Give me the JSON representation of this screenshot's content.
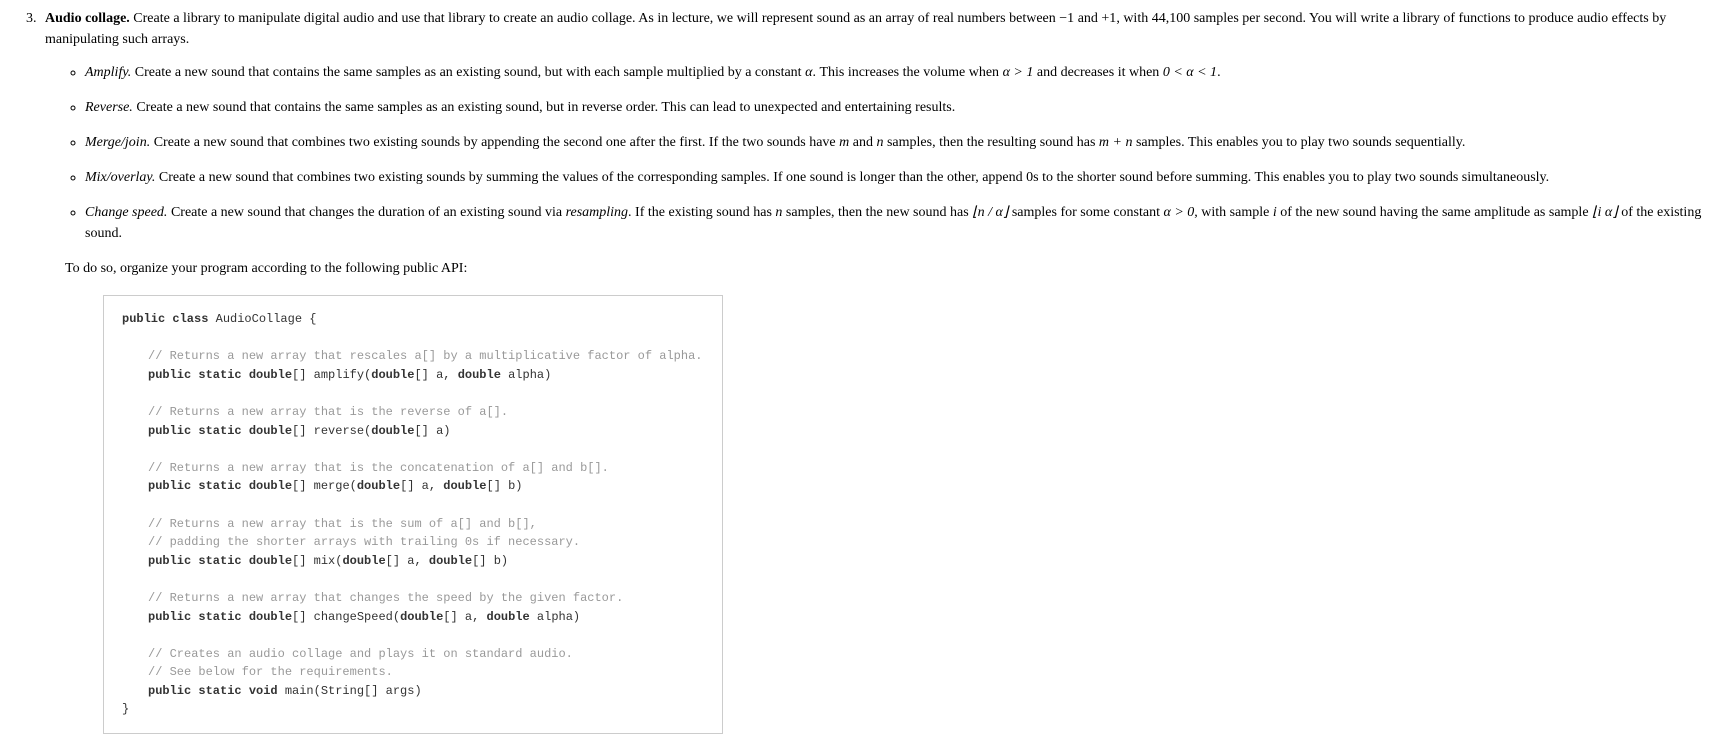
{
  "question": {
    "number": "3",
    "title": "Audio collage.",
    "intro_before": " Create a library to manipulate digital audio and use that library to create an audio collage. As in lecture, we will represent sound as an array of real numbers between ",
    "minus_one": "−1",
    "and_text": " and ",
    "plus_one": "+1",
    "with_text": ", with ",
    "rate": "44,100",
    "intro_after": " samples per second. You will write a library of functions to produce audio effects by manipulating such arrays."
  },
  "items": {
    "amplify": {
      "name": "Amplify.",
      "t1": " Create a new sound that contains the same samples as an existing sound, but with each sample multiplied by a constant ",
      "alpha1": "α",
      "t2": ". This increases the volume when ",
      "cond1": "α > 1",
      "t3": " and decreases it when ",
      "cond2": "0 < α < 1",
      "t4": "."
    },
    "reverse": {
      "name": "Reverse.",
      "t1": " Create a new sound that contains the same samples as an existing sound, but in reverse order. This can lead to unexpected and entertaining results."
    },
    "merge": {
      "name": "Merge/join.",
      "t1": " Create a new sound that combines two existing sounds by appending the second one after the first. If the two sounds have ",
      "m": "m",
      "and": " and ",
      "n": "n",
      "t2": " samples, then the resulting sound has ",
      "mn": "m + n",
      "t3": " samples. This enables you to play two sounds sequentially."
    },
    "mix": {
      "name": "Mix/overlay.",
      "t1": " Create a new sound that combines two existing sounds by summing the values of the corresponding samples. If one sound is longer than the other, append 0s to the shorter sound before summing. This enables you to play two sounds simultaneously."
    },
    "speed": {
      "name": "Change speed.",
      "t1": " Create a new sound that changes the duration of an existing sound via ",
      "resample": "resampling",
      "t2": ". If the existing sound has ",
      "n": "n",
      "t3": " samples, then the new sound has ",
      "floor1": "⌊n / α⌋",
      "t4": " samples for some constant ",
      "cond": "α > 0",
      "t5": ", with sample ",
      "i": "i",
      "t6": " of the new sound having the same amplitude as sample ",
      "floor2": "⌊i α⌋",
      "t7": " of the existing sound."
    }
  },
  "followup": "To do so, organize your program according to the following public API:",
  "code": {
    "l0a": "public class",
    "l0b": " AudioCollage {",
    "c1": "// Returns a new array that rescales a[] by a multiplicative factor of alpha.",
    "s1a": "public static double",
    "s1b": "[] amplify(",
    "s1c": "double",
    "s1d": "[] a, ",
    "s1e": "double",
    "s1f": " alpha)",
    "c2": "// Returns a new array that is the reverse of a[].",
    "s2a": "public static double",
    "s2b": "[] reverse(",
    "s2c": "double",
    "s2d": "[] a)",
    "c3": "// Returns a new array that is the concatenation of a[] and b[].",
    "s3a": "public static double",
    "s3b": "[] merge(",
    "s3c": "double",
    "s3d": "[] a, ",
    "s3e": "double",
    "s3f": "[] b)",
    "c4a": "// Returns a new array that is the sum of a[] and b[],",
    "c4b": "// padding the shorter arrays with trailing 0s if necessary.",
    "s4a": "public static double",
    "s4b": "[] mix(",
    "s4c": "double",
    "s4d": "[] a, ",
    "s4e": "double",
    "s4f": "[] b)",
    "c5": "// Returns a new array that changes the speed by the given factor.",
    "s5a": "public static double",
    "s5b": "[] changeSpeed(",
    "s5c": "double",
    "s5d": "[] a, ",
    "s5e": "double",
    "s5f": " alpha)",
    "c6a": "// Creates an audio collage and plays it on standard audio.",
    "c6b": "// See below for the requirements.",
    "s6a": "public static void",
    "s6b": " main(String[] args)",
    "close": "}"
  }
}
